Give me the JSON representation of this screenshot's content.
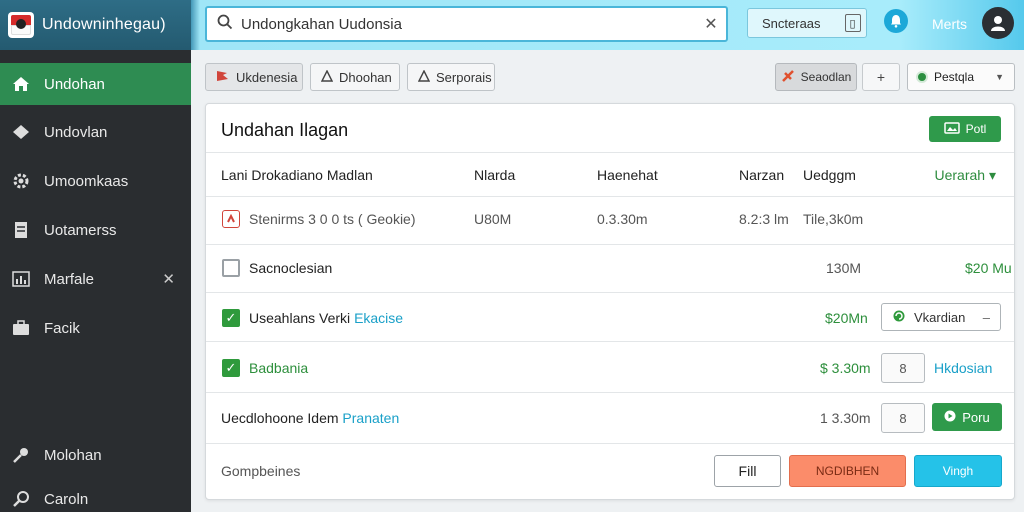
{
  "app": {
    "brand_name": "Undowninhegau)",
    "search_value": "Undongkahan Uudonsia",
    "search_button": "Sncteraas",
    "user_label": "Merts"
  },
  "sidebar": {
    "items": [
      {
        "label": "Undohan",
        "icon": "home-icon",
        "active": true
      },
      {
        "label": "Undovlan",
        "icon": "diamond-icon"
      },
      {
        "label": "Umoomkaas",
        "icon": "settings-icon"
      },
      {
        "label": "Uotamerss",
        "icon": "document-icon"
      },
      {
        "label": "Marfale",
        "icon": "chart-icon",
        "closable": true
      },
      {
        "label": "Facik",
        "icon": "briefcase-icon"
      },
      {
        "label": "Molohan",
        "icon": "key-icon"
      },
      {
        "label": "Caroln",
        "icon": "magnifier-icon"
      }
    ]
  },
  "toolbar": {
    "chips": [
      "Ukdenesia",
      "Dhoohan",
      "Serporais"
    ],
    "sidebar_button": "Seaodlan",
    "plus": "+",
    "filter_value": "Pestqla"
  },
  "panel": {
    "title": "Undahan Ilagan",
    "post_button": "Potl",
    "columns": [
      "Lani Drokadiano Madlan",
      "Nlarda",
      "Haenehat",
      "Narzan",
      "Uedggm"
    ],
    "sort_label": "Uerarah",
    "rows": [
      {
        "name": "Stenirms 3 0 0 ts ( Geokie)",
        "c2": "U80M",
        "c3": "0.3.30m",
        "c4": "8.2:3 lm",
        "c5": "Tile,3k0m"
      },
      {
        "name": "Sacnoclesian",
        "amount": "130M",
        "value": "$20 Mu"
      },
      {
        "name": "Useahlans Verki",
        "link": "Ekacise",
        "amount": "$20Mn",
        "select": "Vkardian"
      },
      {
        "name": "Badbania",
        "amount": "$ 3.30m",
        "link": "Hkdosian",
        "icon_btn": "8"
      },
      {
        "name": "Uecdlohoone Idem",
        "link": "Pranaten",
        "amount": "1 3.30m",
        "icon_btn": "8",
        "action": "Poru"
      }
    ],
    "footer_label": "Gompbeines",
    "fill_button": "Fill",
    "cancel_button": "NGDIBHEN",
    "go_button": "Vingh"
  },
  "colors": {
    "accent_green": "#2e8c52",
    "accent_cyan": "#25c2e8",
    "danger": "#fb8c6a"
  }
}
